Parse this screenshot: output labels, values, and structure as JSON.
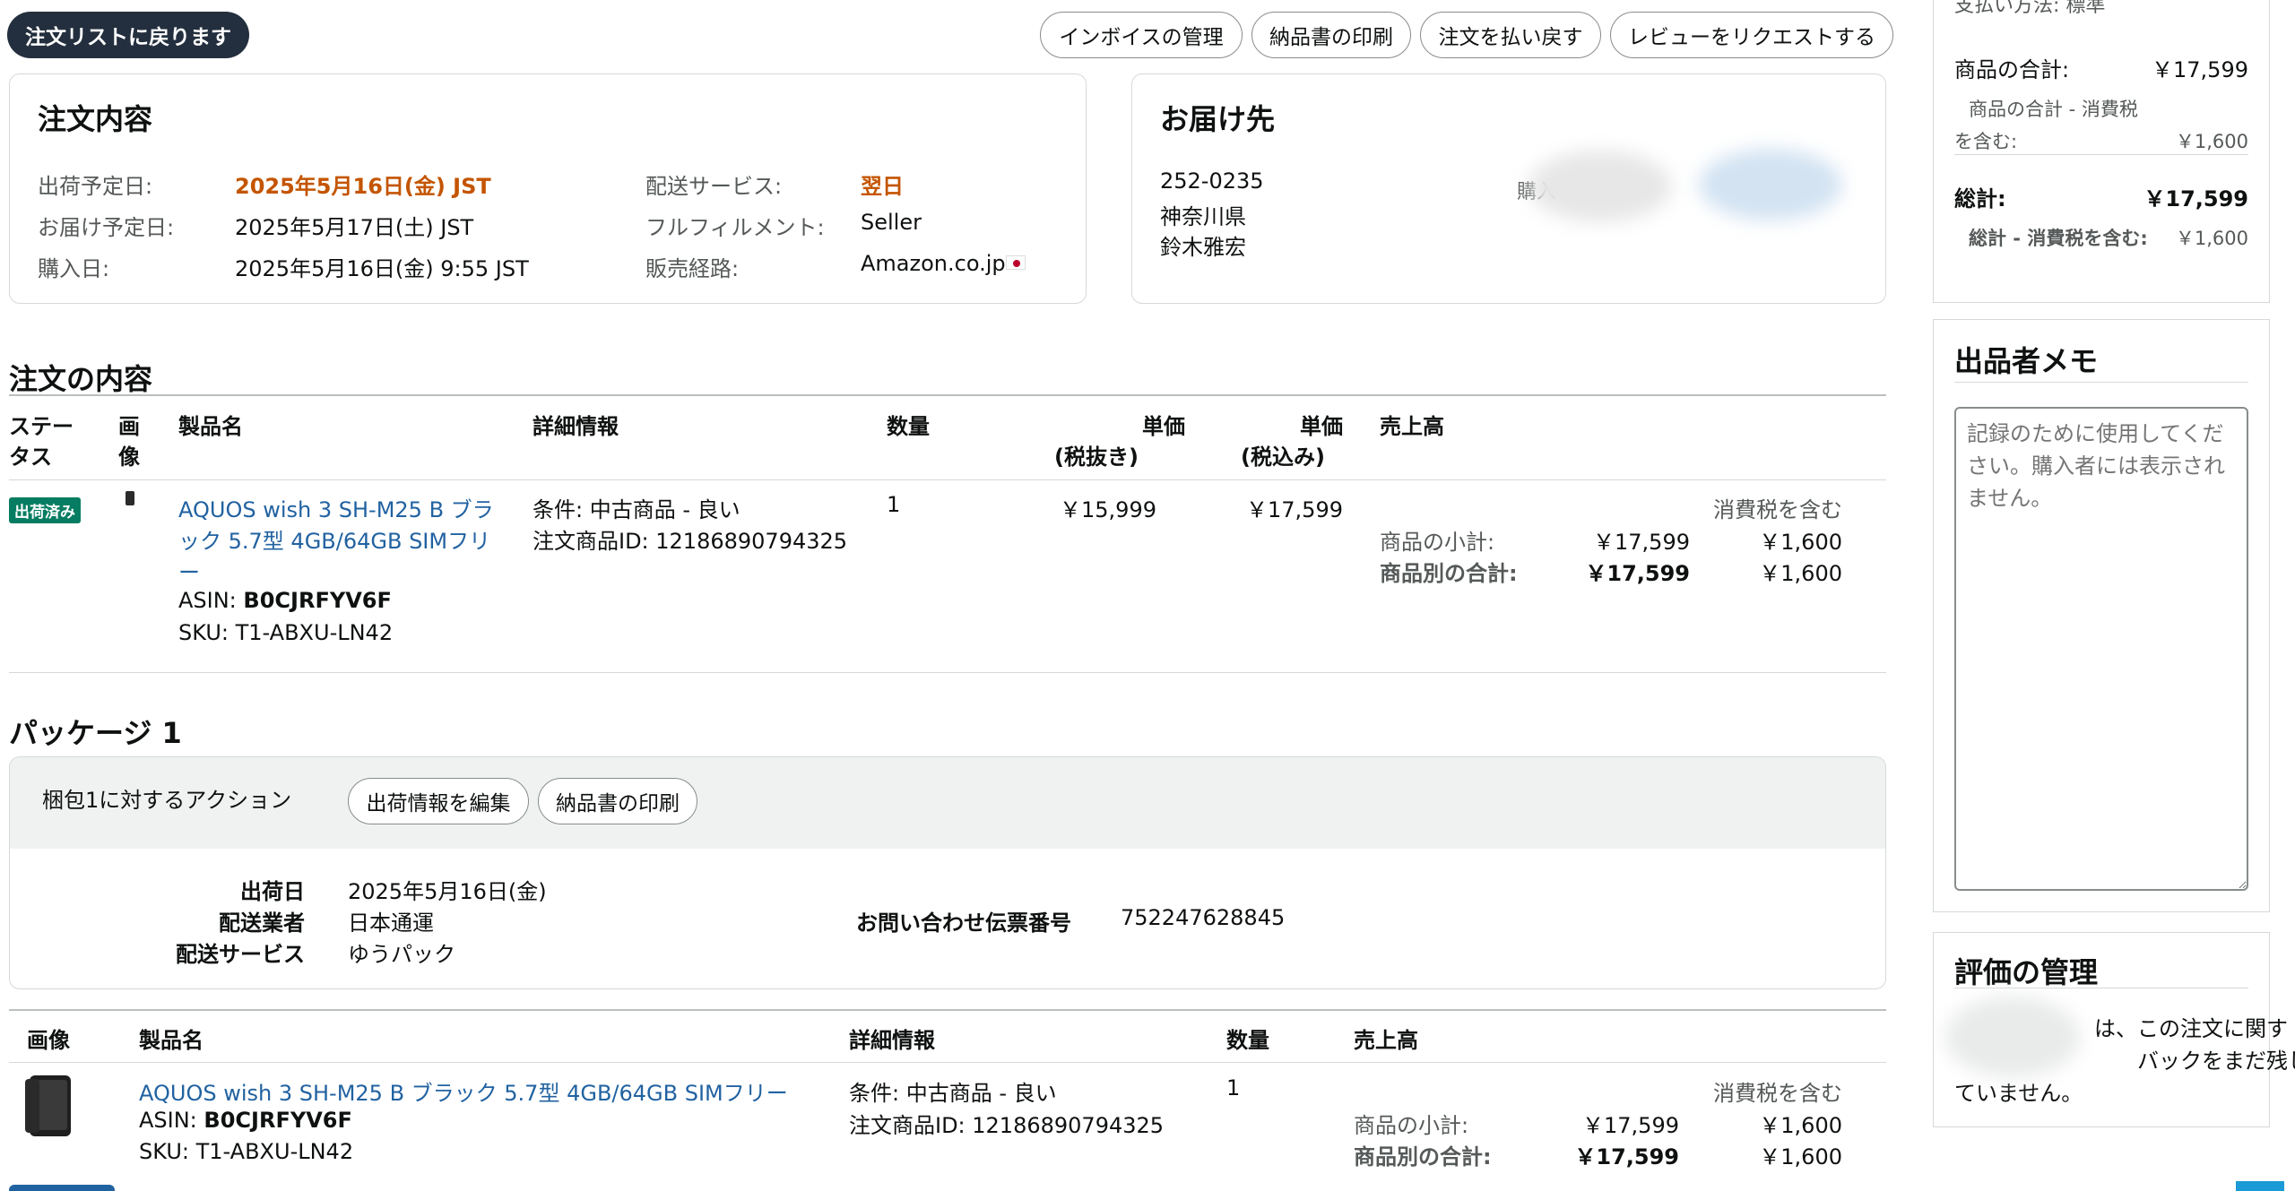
{
  "toolbar": {
    "back_label": "注文リストに戻ります",
    "invoice_label": "インボイスの管理",
    "print_slip_label": "納品書の印刷",
    "refund_label": "注文を払い戻す",
    "request_review_label": "レビューをリクエストする"
  },
  "order_details": {
    "title": "注文内容",
    "ship_by_label": "出荷予定日:",
    "ship_by_value": "2025年5月16日(金) JST",
    "deliver_by_label": "お届け予定日:",
    "deliver_by_value": "2025年5月17日(土) JST",
    "purchase_date_label": "購入日:",
    "purchase_date_value": "2025年5月16日(金) 9:55 JST",
    "shipping_service_label": "配送サービス:",
    "shipping_service_value": "翌日",
    "fulfillment_label": "フルフィルメント:",
    "fulfillment_value": "Seller",
    "sales_channel_label": "販売経路:",
    "sales_channel_value": "Amazon.co.jp"
  },
  "ship_to": {
    "title": "お届け先",
    "postal_code": "252-0235",
    "prefecture": "神奈川県",
    "name": "鈴木雅宏",
    "buyer_label_partial": "購入"
  },
  "order_contents": {
    "title": "注文の内容",
    "headers": {
      "status_1": "ステー",
      "status_2": "タス",
      "image_1": "画",
      "image_2": "像",
      "product": "製品名",
      "details": "詳細情報",
      "quantity": "数量",
      "unit_price_ex_1": "単価",
      "unit_price_ex_2": "(税抜き)",
      "unit_price_in_1": "単価",
      "unit_price_in_2": "(税込み)",
      "sales": "売上高"
    },
    "row": {
      "status": "出荷済み",
      "product_line1": "AQUOS wish 3 SH-M25 B ブラ",
      "product_line2": "ック 5.7型 4GB/64GB SIMフリ",
      "product_line3": "ー",
      "asin_label": "ASIN:",
      "asin": "B0CJRFYV6F",
      "sku": "SKU: T1-ABXU-LN42",
      "condition": "条件: 中古商品 - 良い",
      "order_item_id": "注文商品ID: 12186890794325",
      "quantity": "1",
      "unit_price_ex": "￥15,999",
      "unit_price_in": "￥17,599",
      "tax_included_label": "消費税を含む",
      "subtotal_label": "商品の小計:",
      "subtotal_value": "￥17,599",
      "subtotal_tax": "￥1,600",
      "item_total_label": "商品別の合計:",
      "item_total_value": "￥17,599",
      "item_total_tax": "￥1,600"
    }
  },
  "package": {
    "title": "パッケージ 1",
    "actions_label": "梱包1に対するアクション",
    "edit_shipment_label": "出荷情報を編集",
    "print_slip_label": "納品書の印刷",
    "ship_date_label": "出荷日",
    "ship_date_value": "2025年5月16日(金)",
    "carrier_label": "配送業者",
    "carrier_value": "日本通運",
    "service_label": "配送サービス",
    "service_value": "ゆうパック",
    "tracking_label": "お問い合わせ伝票番号",
    "tracking_value": "752247628845",
    "headers": {
      "image": "画像",
      "product": "製品名",
      "details": "詳細情報",
      "quantity": "数量",
      "sales": "売上高"
    },
    "row": {
      "product": "AQUOS wish 3 SH-M25 B ブラック 5.7型 4GB/64GB SIMフリー",
      "asin_label": "ASIN:",
      "asin": "B0CJRFYV6F",
      "sku": "SKU: T1-ABXU-LN42",
      "condition": "条件: 中古商品 - 良い",
      "order_item_id": "注文商品ID: 12186890794325",
      "quantity": "1",
      "tax_included_label": "消費税を含む",
      "subtotal_label": "商品の小計:",
      "subtotal_value": "￥17,599",
      "subtotal_tax": "￥1,600",
      "item_total_label": "商品別の合計:",
      "item_total_value": "￥17,599",
      "item_total_tax": "￥1,600"
    }
  },
  "summary": {
    "payment_method_partial": "支払い方法: 標準",
    "items_total_label": "商品の合計:",
    "items_total_value": "￥17,599",
    "items_tax_label_1": "商品の合計 - 消費税",
    "items_tax_label_2": "を含む:",
    "items_tax_value": "￥1,600",
    "grand_total_label": "総計:",
    "grand_total_value": "￥17,599",
    "grand_tax_label": "総計 - 消費税を含む:",
    "grand_tax_value": "￥1,600"
  },
  "seller_memo": {
    "title": "出品者メモ",
    "placeholder": "記録のために使用してください。購入者には表示されません。"
  },
  "feedback": {
    "title": "評価の管理",
    "text_line1": "は、この注文に関す",
    "text_line2": "バックをまだ残し",
    "text_line3": "ていません。"
  },
  "colors": {
    "link": "#2162a1",
    "highlight": "#c45500",
    "badge": "#067d62",
    "dark_button": "#232f3e"
  }
}
